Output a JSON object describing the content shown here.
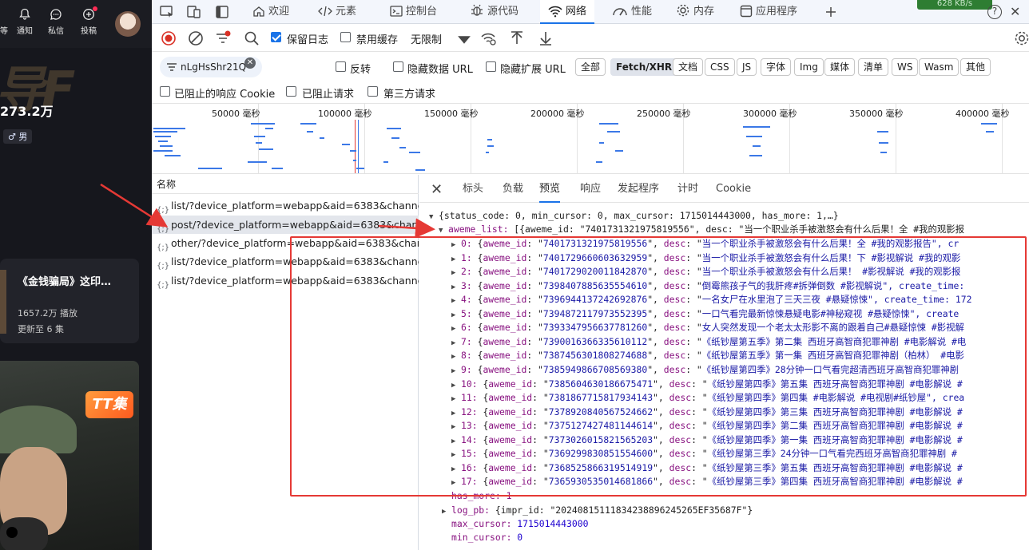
{
  "page": {
    "top_nav": [
      {
        "label": "通知"
      },
      {
        "label": "私信"
      },
      {
        "label": "投稿"
      }
    ],
    "fans_count": "273.2万",
    "gender": "♂ 男",
    "card": {
      "title": "《金钱骗局》这印…",
      "plays": "1657.2万 播放",
      "update": "更新至 6 集"
    },
    "badge": "TT集"
  },
  "devtools": {
    "tabs": [
      {
        "label": "欢迎",
        "icon": "home-icon"
      },
      {
        "label": "元素",
        "icon": "code-icon"
      },
      {
        "label": "控制台",
        "icon": "console-icon"
      },
      {
        "label": "源代码",
        "icon": "bug-icon"
      },
      {
        "label": "网络",
        "icon": "wifi-icon"
      },
      {
        "label": "性能",
        "icon": "gauge-icon"
      },
      {
        "label": "内存",
        "icon": "gear-icon"
      },
      {
        "label": "应用程序",
        "icon": "app-icon"
      }
    ],
    "net_speed": "628 KB/s",
    "toolbar": {
      "preserve_log": "保留日志",
      "disable_cache": "禁用缓存",
      "throttle": "无限制"
    },
    "filter": {
      "value": "nLgHsShr21Q",
      "invert": "反转",
      "hide_data_url": "隐藏数据 URL",
      "hide_ext_url": "隐藏扩展 URL",
      "types": [
        "全部",
        "Fetch/XHR",
        "文档",
        "CSS",
        "JS",
        "字体",
        "Img",
        "媒体",
        "清单",
        "WS",
        "Wasm",
        "其他"
      ],
      "selected_type": "Fetch/XHR",
      "blocked_cookies": "已阻止的响应 Cookie",
      "blocked_requests": "已阻止请求",
      "third_party": "第三方请求"
    },
    "overview_ticks": [
      "50000 毫秒",
      "100000 毫秒",
      "150000 毫秒",
      "200000 毫秒",
      "250000 毫秒",
      "300000 毫秒",
      "350000 毫秒",
      "400000 毫秒"
    ],
    "requests": {
      "header": "名称",
      "items": [
        "list/?device_platform=webapp&aid=6383&channe…",
        "post/?device_platform=webapp&aid=6383&chan…",
        "other/?device_platform=webapp&aid=6383&channe…",
        "list/?device_platform=webapp&aid=6383&channe…",
        "list/?device_platform=webapp&aid=6383&channe…"
      ]
    },
    "detail_tabs": [
      "标头",
      "负载",
      "预览",
      "响应",
      "发起程序",
      "计时",
      "Cookie"
    ],
    "preview": {
      "root": "{status_code: 0, min_cursor: 0, max_cursor: 1715014443000, has_more: 1,…}",
      "aweme_list_key": "aweme_list:",
      "aweme_list_summary": "[{aweme_id: \"7401731321975819556\", desc: \"当一个职业杀手被激怒会有什么后果！全 #我的观影报",
      "items": [
        {
          "i": "0",
          "id": "7401731321975819556",
          "desc": "当一个职业杀手被激怒会有什么后果！全 #我的观影报告\", cr"
        },
        {
          "i": "1",
          "id": "7401729660603632959",
          "desc": "当一个职业杀手被激怒会有什么后果！下 #影视解说 #我的观影"
        },
        {
          "i": "2",
          "id": "7401729020011842870",
          "desc": "当一个职业杀手被激怒会有什么后果！ #影视解说 #我的观影报"
        },
        {
          "i": "3",
          "id": "7398407885635554610",
          "desc": "倒霉熊孩子气的我肝疼#拆弹倒数 #影视解说\", create_time:"
        },
        {
          "i": "4",
          "id": "7396944137242692876",
          "desc": "一名女尸在水里泡了三天三夜 #悬疑惊悚\", create_time: 172"
        },
        {
          "i": "5",
          "id": "7394872117973552395",
          "desc": "一口气看完最新惊悚悬疑电影#神秘窥视 #悬疑惊悚\", create"
        },
        {
          "i": "6",
          "id": "7393347956637781260",
          "desc": "女人突然发现一个老太太形影不离的跟着自己#悬疑惊悚 #影视解"
        },
        {
          "i": "7",
          "id": "7390016366335610112",
          "desc": "《纸钞屋第五季》第二集 西班牙高智商犯罪神剧 #电影解说 #电"
        },
        {
          "i": "8",
          "id": "7387456301808274688",
          "desc": "《纸钞屋第五季》第一集 西班牙高智商犯罪神剧（柏林） #电影"
        },
        {
          "i": "9",
          "id": "7385949866708569380",
          "desc": "《纸钞屋第四季》28分钟一口气看完超清西班牙高智商犯罪神剧"
        },
        {
          "i": "10",
          "id": "7385604630186675471",
          "desc": "《纸钞屋第四季》第五集 西班牙高智商犯罪神剧 #电影解说 #"
        },
        {
          "i": "11",
          "id": "7381867715817934143",
          "desc": "《纸钞屋第四季》第四集 #电影解说 #电视剧#纸钞屋\", crea"
        },
        {
          "i": "12",
          "id": "7378920840567524662",
          "desc": "《纸钞屋第四季》第三集 西班牙高智商犯罪神剧 #电影解说 #"
        },
        {
          "i": "13",
          "id": "7375127427481144614",
          "desc": "《纸钞屋第四季》第二集 西班牙高智商犯罪神剧 #电影解说 #"
        },
        {
          "i": "14",
          "id": "7373026015821565203",
          "desc": "《纸钞屋第四季》第一集 西班牙高智商犯罪神剧 #电影解说 #"
        },
        {
          "i": "15",
          "id": "7369299830851554600",
          "desc": "《纸钞屋第三季》24分钟一口气看完西班牙高智商犯罪神剧 #"
        },
        {
          "i": "16",
          "id": "7368525866319514919",
          "desc": "《纸钞屋第三季》第五集 西班牙高智商犯罪神剧 #电影解说 #"
        },
        {
          "i": "17",
          "id": "7365930535014681866",
          "desc": "《纸钞屋第三季》第四集 西班牙高智商犯罪神剧 #电影解说 #"
        }
      ],
      "has_more": "has_more: 1",
      "log_pb": "{impr_id: \"20240815111834238896245265EF35687F\"}",
      "max_cursor": "1715014443000",
      "min_cursor": "0"
    }
  },
  "colors": {
    "accent": "#1a73e8",
    "highlight": "#e53935"
  }
}
